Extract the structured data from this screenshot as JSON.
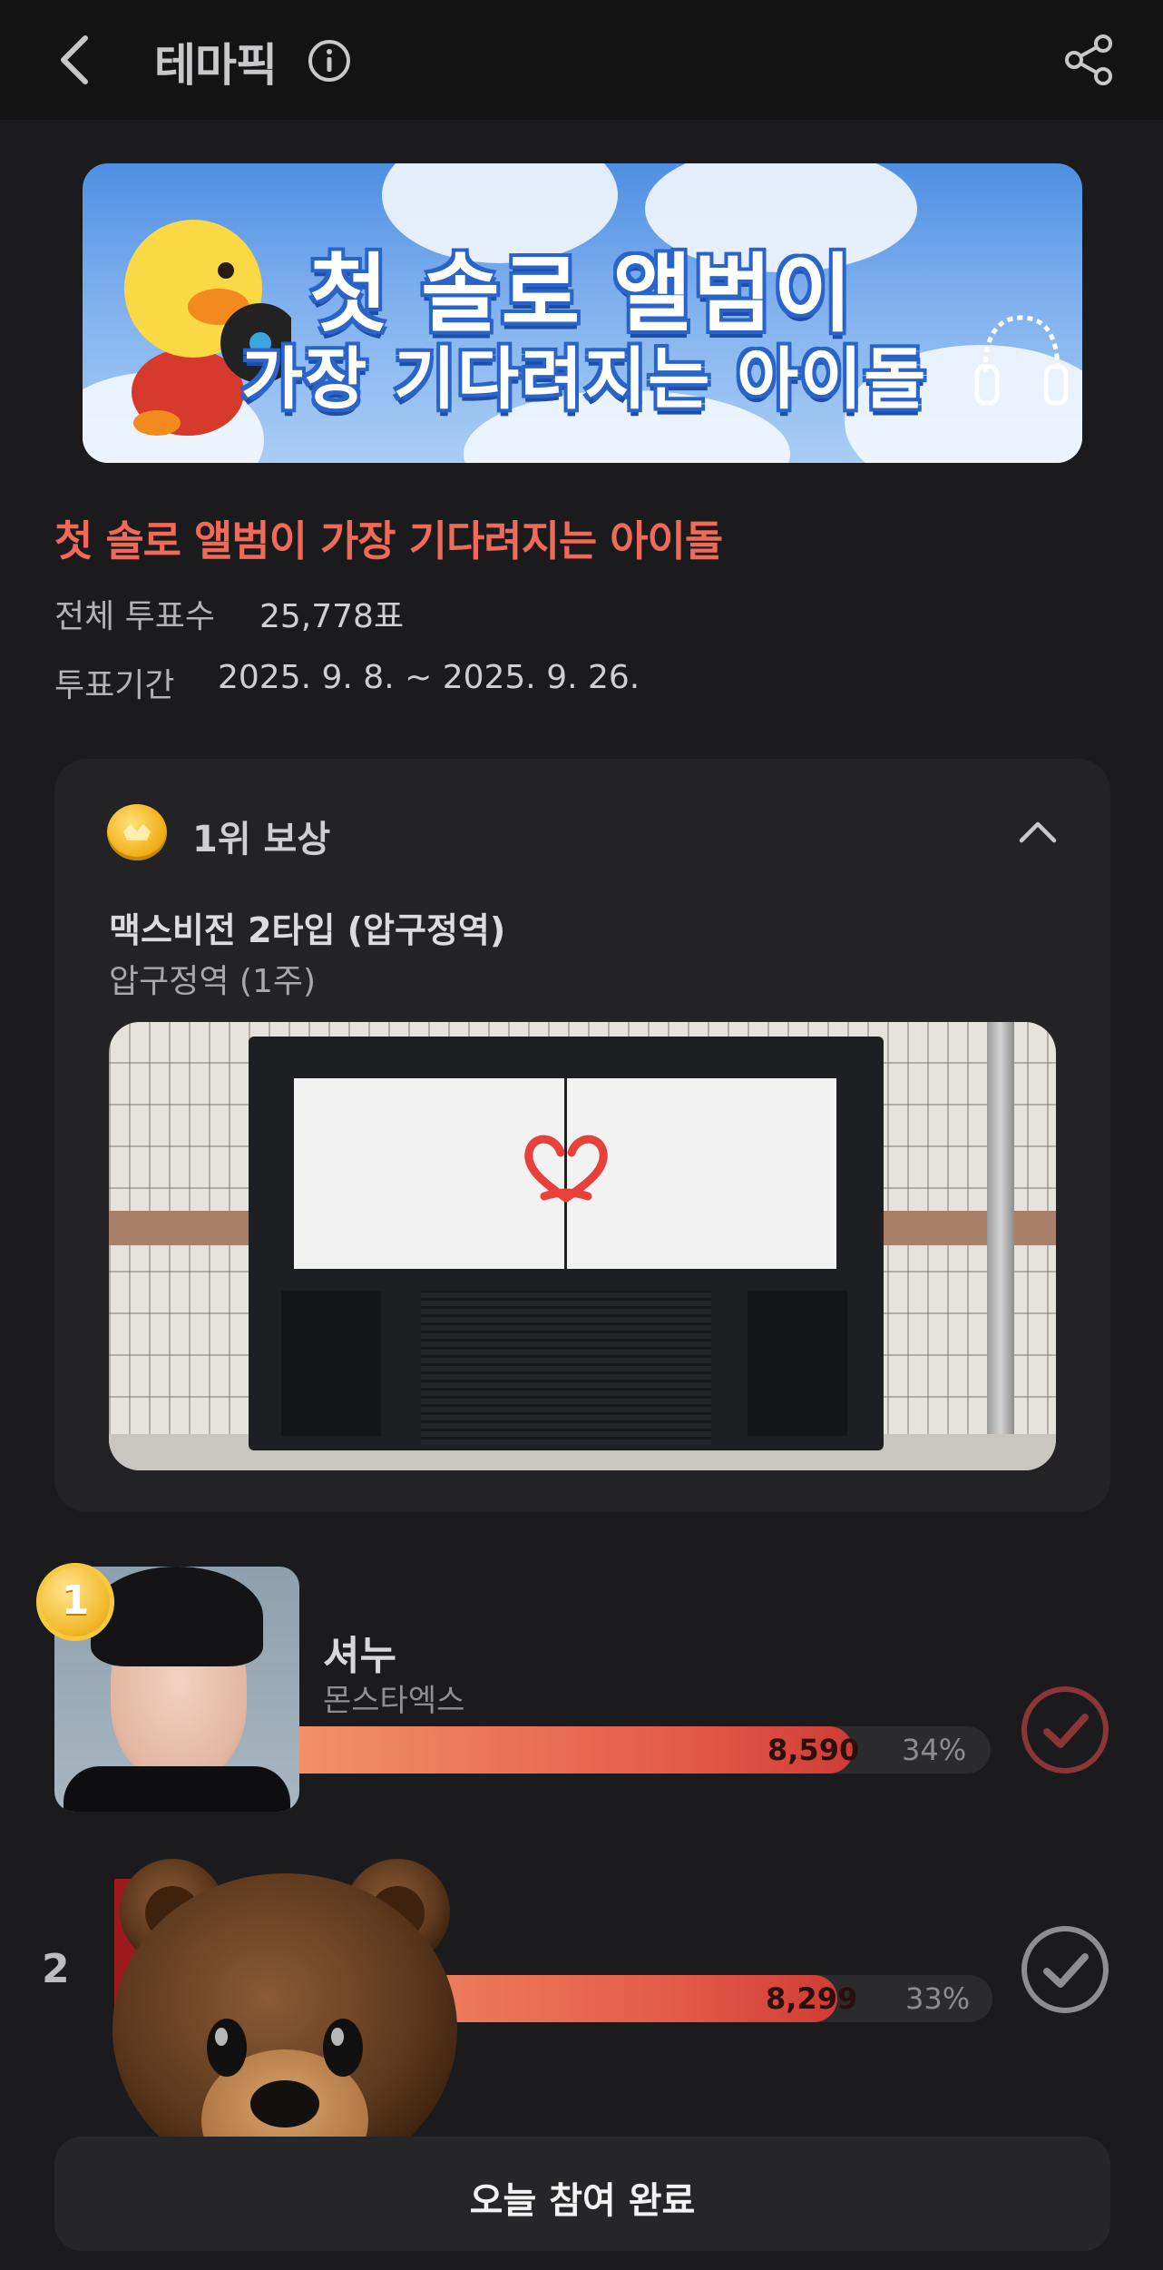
{
  "header": {
    "title": "테마픽",
    "icons": [
      "back-icon",
      "info-icon",
      "share-icon"
    ]
  },
  "banner": {
    "line1": "첫 솔로 앨범이",
    "line2": "가장 기다려지는 아이돌"
  },
  "theme": {
    "title": "첫 솔로 앨범이 가장 기다려지는 아이돌",
    "total_votes_label": "전체 투표수",
    "total_votes_value": "25,778표",
    "period_label": "투표기간",
    "period_value": "2025. 9. 8. ~ 2025. 9. 26."
  },
  "reward": {
    "heading": "1위 보상",
    "ad_title": "맥스비전 2타입 (압구정역)",
    "ad_subtitle": "압구정역 (1주)"
  },
  "ranking": [
    {
      "rank": "1",
      "name": "셔누",
      "group": "몬스타엑스",
      "votes": "8,590",
      "percent": "34%",
      "share": 0.34
    },
    {
      "rank": "2",
      "votes": "8,299",
      "percent": "33%",
      "share": 0.33
    }
  ],
  "footer": {
    "done_label": "오늘 참여 완료"
  },
  "colors": {
    "accent": "#f06a5a",
    "background": "#1b1b1d",
    "card": "#232325",
    "bar_start": "#f2906a",
    "bar_end": "#cf3c36"
  }
}
